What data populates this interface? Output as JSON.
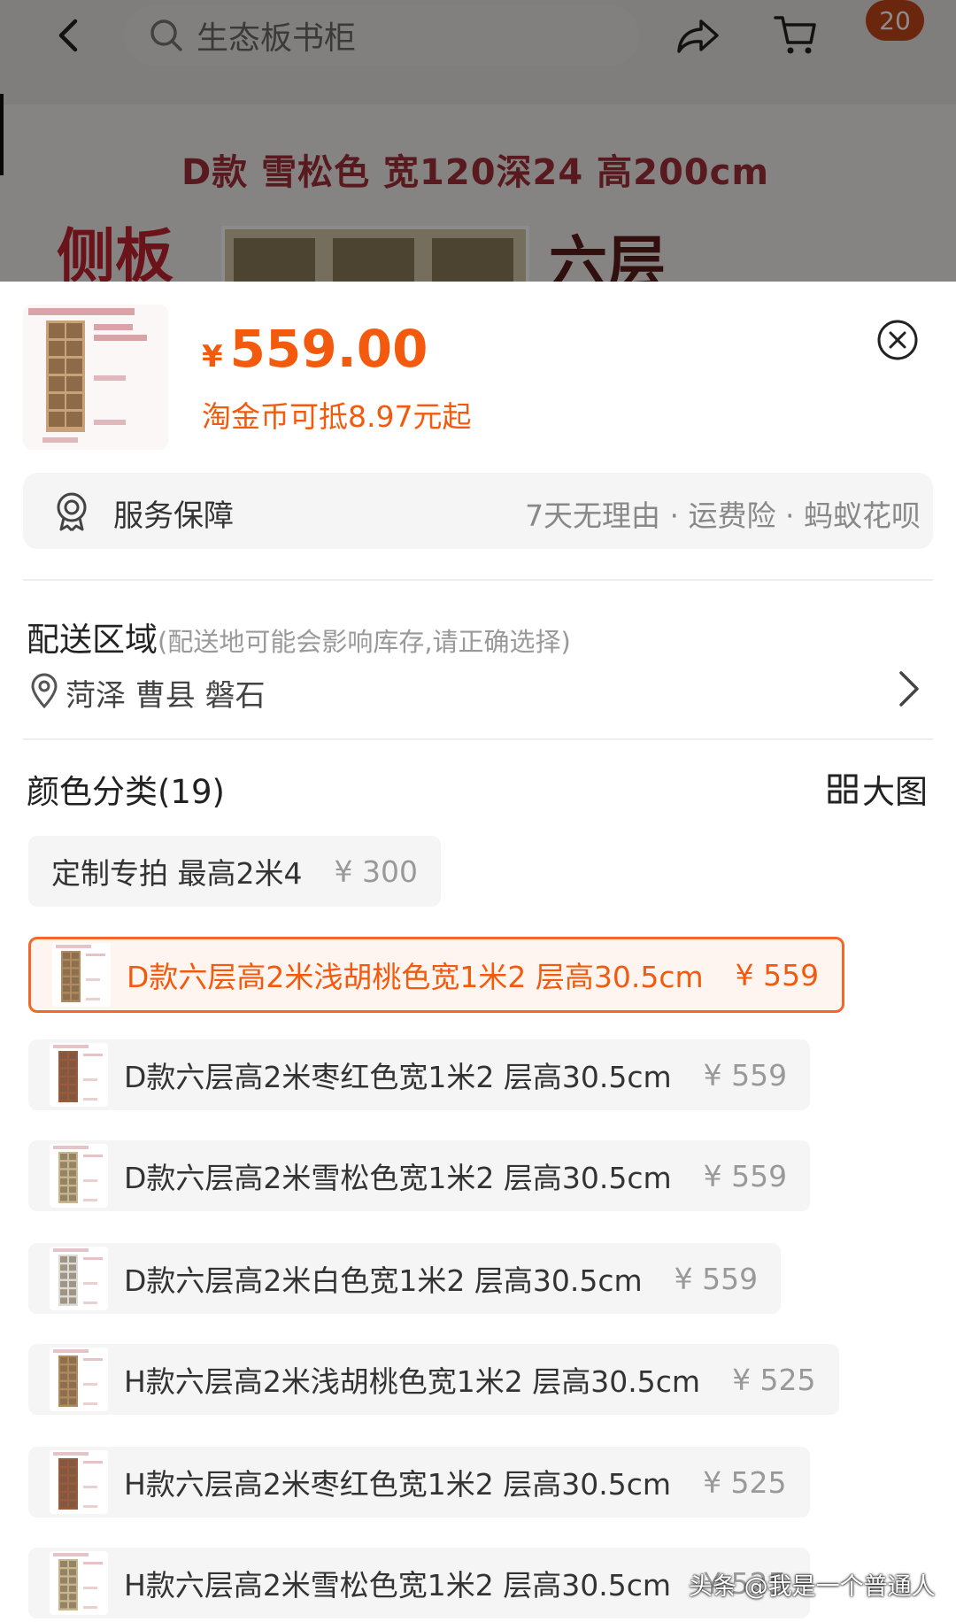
{
  "header": {
    "search_placeholder": "生态板书柜",
    "cart_badge": "20"
  },
  "background": {
    "banner_line": "D款 雪松色 宽120深24 高200cm",
    "side_label": "侧板",
    "layers_label": "六层"
  },
  "product": {
    "currency": "¥",
    "price": "559.00",
    "coin_note": "淘金币可抵8.97元起"
  },
  "service": {
    "title": "服务保障",
    "items": "7天无理由 · 运费险 · 蚂蚁花呗"
  },
  "delivery": {
    "title": "配送区域",
    "hint": "(配送地可能会影响库存,请正确选择)",
    "address": "菏泽 曹县 磐石"
  },
  "category": {
    "title": "颜色分类(19)",
    "big_image_label": "大图",
    "options": [
      {
        "name": "定制专拍 最高2米4",
        "price": "¥ 300",
        "has_image": false,
        "selected": false,
        "shelf_color": ""
      },
      {
        "name": "D款六层高2米浅胡桃色宽1米2 层高30.5cm",
        "price": "¥ 559",
        "has_image": true,
        "selected": true,
        "shelf_color": "#b08a5e"
      },
      {
        "name": "D款六层高2米枣红色宽1米2 层高30.5cm",
        "price": "¥ 559",
        "has_image": true,
        "selected": false,
        "shelf_color": "#9a5a3c"
      },
      {
        "name": "D款六层高2米雪松色宽1米2 层高30.5cm",
        "price": "¥ 559",
        "has_image": true,
        "selected": false,
        "shelf_color": "#c6b78e"
      },
      {
        "name": "D款六层高2米白色宽1米2 层高30.5cm",
        "price": "¥ 559",
        "has_image": true,
        "selected": false,
        "shelf_color": "#dcdcd6"
      },
      {
        "name": "H款六层高2米浅胡桃色宽1米2 层高30.5cm",
        "price": "¥ 525",
        "has_image": true,
        "selected": false,
        "shelf_color": "#b08a5e"
      },
      {
        "name": "H款六层高2米枣红色宽1米2 层高30.5cm",
        "price": "¥ 525",
        "has_image": true,
        "selected": false,
        "shelf_color": "#9a5a3c"
      },
      {
        "name": "H款六层高2米雪松色宽1米2 层高30.5cm",
        "price": "¥ 525",
        "has_image": true,
        "selected": false,
        "shelf_color": "#c6b78e"
      }
    ]
  },
  "watermark": "头条 @我是一个普通人",
  "colors": {
    "accent": "#f45a0d",
    "badge": "#c4451a",
    "selected_border": "#f4672a"
  }
}
